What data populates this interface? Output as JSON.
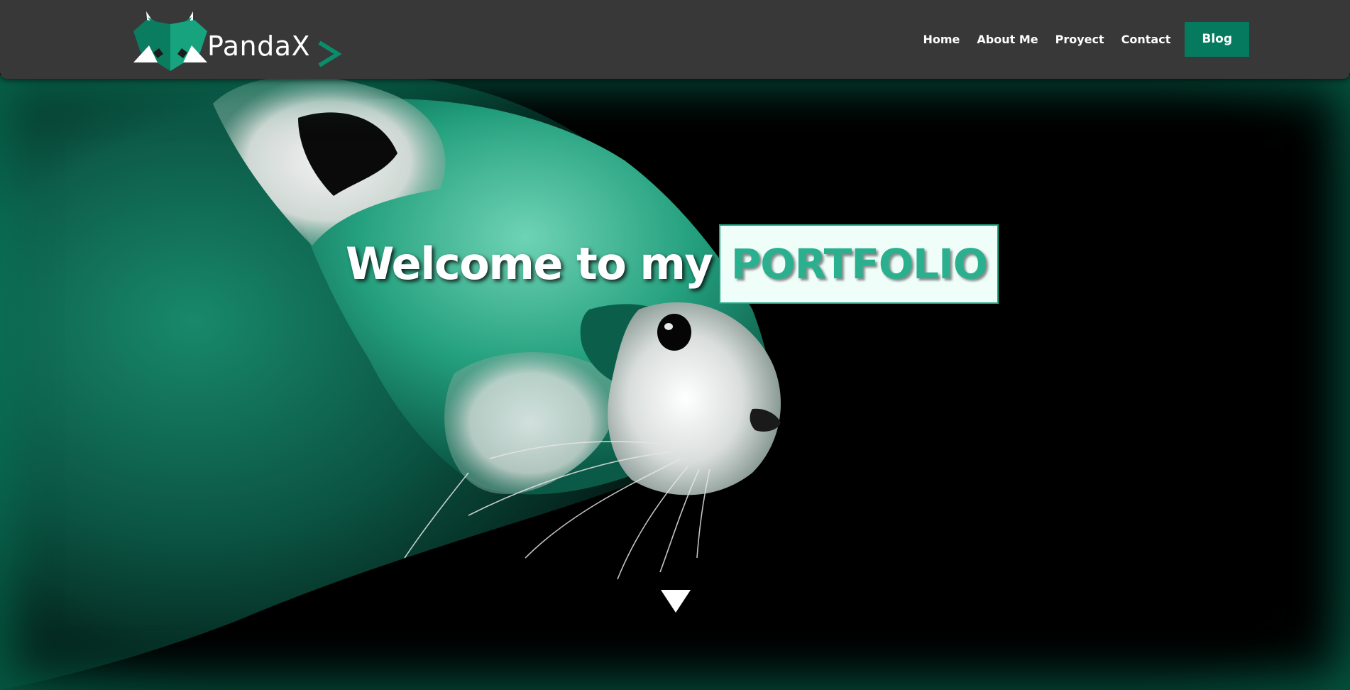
{
  "brand": {
    "name": "PandaX",
    "chevron": ">",
    "logo_icon": "panda-head-icon"
  },
  "nav": {
    "items": [
      {
        "label": "Home"
      },
      {
        "label": "About Me"
      },
      {
        "label": "Proyect"
      },
      {
        "label": "Contact"
      }
    ],
    "cta": {
      "label": "Blog"
    }
  },
  "hero": {
    "headline_plain": "Welcome to my",
    "headline_accent": "PORTFOLIO",
    "scroll_icon": "triangle-down-icon"
  },
  "colors": {
    "navbar": "#383838",
    "accent": "#067a5e",
    "accent_text": "#2bb08f",
    "accent_box": "#f0fefa"
  }
}
